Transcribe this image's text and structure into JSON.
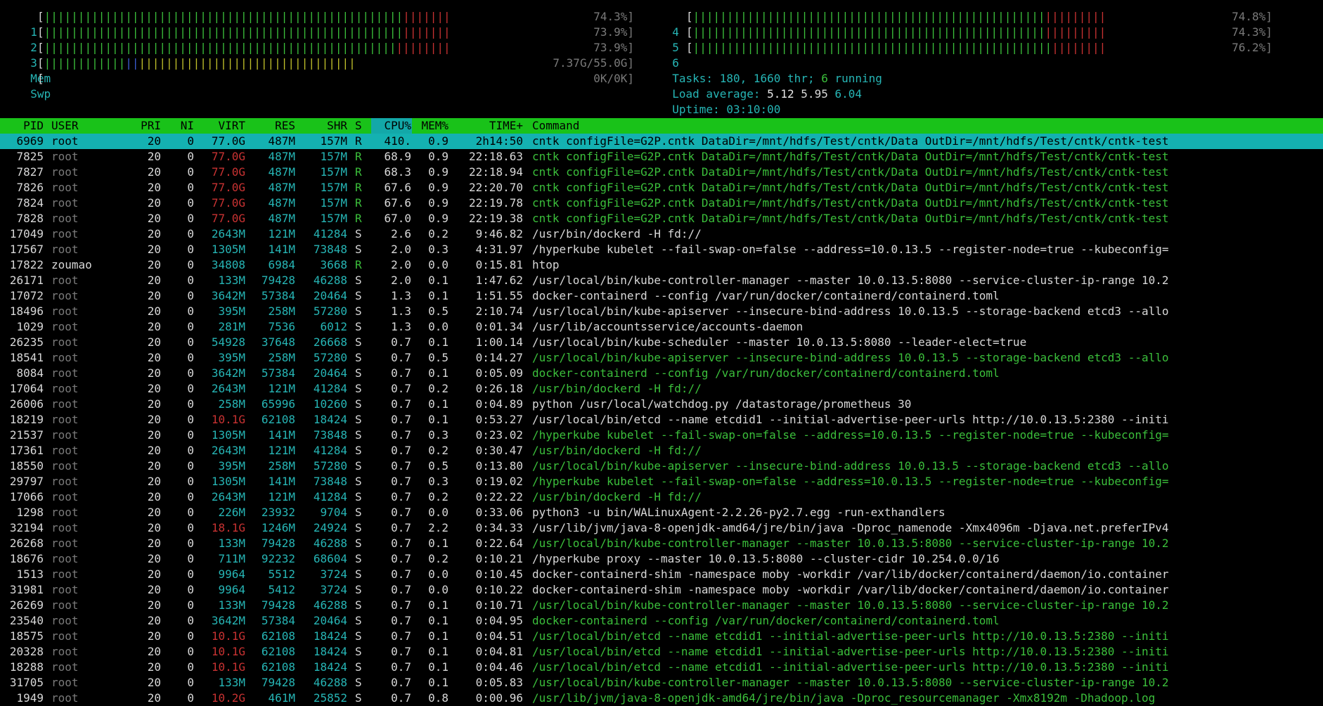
{
  "cpu_meters": [
    {
      "label": "1",
      "green": 53,
      "red": 7,
      "value": "74.3%]"
    },
    {
      "label": "2",
      "green": 53,
      "red": 7,
      "value": "73.9%]"
    },
    {
      "label": "3",
      "green": 52,
      "red": 8,
      "value": "73.9%]"
    },
    {
      "label": "4",
      "green": 52,
      "red": 9,
      "value": "74.8%]"
    },
    {
      "label": "5",
      "green": 52,
      "red": 9,
      "value": "74.3%]"
    },
    {
      "label": "6",
      "green": 53,
      "red": 8,
      "value": "76.2%]"
    }
  ],
  "mem": {
    "label": "Mem",
    "value": "7.37G/55.0G]"
  },
  "swp": {
    "label": "Swp",
    "value": "0K/0K]"
  },
  "tasks": {
    "label": "Tasks: ",
    "count": "180",
    "sep": ", ",
    "threads": "1660",
    "thr": " thr; ",
    "running": "6",
    "running_label": " running"
  },
  "load": {
    "label": "Load average: ",
    "v1": "5.12",
    "v5": "5.95",
    "v15": "6.04"
  },
  "uptime": {
    "label": "Uptime: ",
    "value": "03:10:00"
  },
  "columns": [
    "PID",
    "USER",
    "PRI",
    "NI",
    "VIRT",
    "RES",
    "SHR",
    "S",
    "CPU%",
    "MEM%",
    "TIME+",
    "Command"
  ],
  "processes": [
    {
      "pid": "6969",
      "user": "root",
      "pri": "20",
      "ni": "0",
      "virt": "77.0G",
      "res": "487M",
      "shr": "157M",
      "s": "R",
      "cpu": "410.",
      "mem": "0.9",
      "time": "2h14:50",
      "cmd": "cntk configFile=G2P.cntk DataDir=/mnt/hdfs/Test/cntk/Data OutDir=/mnt/hdfs/Test/cntk/cntk-test",
      "cmdcolor": "sel",
      "sel": true
    },
    {
      "pid": "7825",
      "user": "root",
      "pri": "20",
      "ni": "0",
      "virt": "77.0G",
      "res": "487M",
      "shr": "157M",
      "s": "R",
      "cpu": "68.9",
      "mem": "0.9",
      "time": "22:18.63",
      "cmd": "cntk configFile=G2P.cntk DataDir=/mnt/hdfs/Test/cntk/Data OutDir=/mnt/hdfs/Test/cntk/cntk-test",
      "cmdcolor": "green"
    },
    {
      "pid": "7827",
      "user": "root",
      "pri": "20",
      "ni": "0",
      "virt": "77.0G",
      "res": "487M",
      "shr": "157M",
      "s": "R",
      "cpu": "68.3",
      "mem": "0.9",
      "time": "22:18.94",
      "cmd": "cntk configFile=G2P.cntk DataDir=/mnt/hdfs/Test/cntk/Data OutDir=/mnt/hdfs/Test/cntk/cntk-test",
      "cmdcolor": "green"
    },
    {
      "pid": "7826",
      "user": "root",
      "pri": "20",
      "ni": "0",
      "virt": "77.0G",
      "res": "487M",
      "shr": "157M",
      "s": "R",
      "cpu": "67.6",
      "mem": "0.9",
      "time": "22:20.70",
      "cmd": "cntk configFile=G2P.cntk DataDir=/mnt/hdfs/Test/cntk/Data OutDir=/mnt/hdfs/Test/cntk/cntk-test",
      "cmdcolor": "green"
    },
    {
      "pid": "7824",
      "user": "root",
      "pri": "20",
      "ni": "0",
      "virt": "77.0G",
      "res": "487M",
      "shr": "157M",
      "s": "R",
      "cpu": "67.6",
      "mem": "0.9",
      "time": "22:19.78",
      "cmd": "cntk configFile=G2P.cntk DataDir=/mnt/hdfs/Test/cntk/Data OutDir=/mnt/hdfs/Test/cntk/cntk-test",
      "cmdcolor": "green"
    },
    {
      "pid": "7828",
      "user": "root",
      "pri": "20",
      "ni": "0",
      "virt": "77.0G",
      "res": "487M",
      "shr": "157M",
      "s": "R",
      "cpu": "67.0",
      "mem": "0.9",
      "time": "22:19.38",
      "cmd": "cntk configFile=G2P.cntk DataDir=/mnt/hdfs/Test/cntk/Data OutDir=/mnt/hdfs/Test/cntk/cntk-test",
      "cmdcolor": "green"
    },
    {
      "pid": "17049",
      "user": "root",
      "pri": "20",
      "ni": "0",
      "virt": "2643M",
      "res": "121M",
      "shr": "41284",
      "s": "S",
      "cpu": "2.6",
      "mem": "0.2",
      "time": "9:46.82",
      "cmd": "/usr/bin/dockerd -H fd://",
      "cmdcolor": "white"
    },
    {
      "pid": "17567",
      "user": "root",
      "pri": "20",
      "ni": "0",
      "virt": "1305M",
      "res": "141M",
      "shr": "73848",
      "s": "S",
      "cpu": "2.0",
      "mem": "0.3",
      "time": "4:31.97",
      "cmd": "/hyperkube kubelet --fail-swap-on=false --address=10.0.13.5 --register-node=true --kubeconfig=",
      "cmdcolor": "white"
    },
    {
      "pid": "17822",
      "user": "zoumao",
      "pri": "20",
      "ni": "0",
      "virt": "34808",
      "res": "6984",
      "shr": "3668",
      "s": "R",
      "cpu": "2.0",
      "mem": "0.0",
      "time": "0:15.81",
      "cmd": "htop",
      "cmdcolor": "white"
    },
    {
      "pid": "26171",
      "user": "root",
      "pri": "20",
      "ni": "0",
      "virt": "133M",
      "res": "79428",
      "shr": "46288",
      "s": "S",
      "cpu": "2.0",
      "mem": "0.1",
      "time": "1:47.62",
      "cmd": "/usr/local/bin/kube-controller-manager --master 10.0.13.5:8080 --service-cluster-ip-range 10.2",
      "cmdcolor": "white"
    },
    {
      "pid": "17072",
      "user": "root",
      "pri": "20",
      "ni": "0",
      "virt": "3642M",
      "res": "57384",
      "shr": "20464",
      "s": "S",
      "cpu": "1.3",
      "mem": "0.1",
      "time": "1:51.55",
      "cmd": "docker-containerd --config /var/run/docker/containerd/containerd.toml",
      "cmdcolor": "white"
    },
    {
      "pid": "18496",
      "user": "root",
      "pri": "20",
      "ni": "0",
      "virt": "395M",
      "res": "258M",
      "shr": "57280",
      "s": "S",
      "cpu": "1.3",
      "mem": "0.5",
      "time": "2:10.74",
      "cmd": "/usr/local/bin/kube-apiserver --insecure-bind-address 10.0.13.5 --storage-backend etcd3 --allo",
      "cmdcolor": "white"
    },
    {
      "pid": "1029",
      "user": "root",
      "pri": "20",
      "ni": "0",
      "virt": "281M",
      "res": "7536",
      "shr": "6012",
      "s": "S",
      "cpu": "1.3",
      "mem": "0.0",
      "time": "0:01.34",
      "cmd": "/usr/lib/accountsservice/accounts-daemon",
      "cmdcolor": "white"
    },
    {
      "pid": "26235",
      "user": "root",
      "pri": "20",
      "ni": "0",
      "virt": "54928",
      "res": "37648",
      "shr": "26668",
      "s": "S",
      "cpu": "0.7",
      "mem": "0.1",
      "time": "1:00.14",
      "cmd": "/usr/local/bin/kube-scheduler --master 10.0.13.5:8080 --leader-elect=true",
      "cmdcolor": "white"
    },
    {
      "pid": "18541",
      "user": "root",
      "pri": "20",
      "ni": "0",
      "virt": "395M",
      "res": "258M",
      "shr": "57280",
      "s": "S",
      "cpu": "0.7",
      "mem": "0.5",
      "time": "0:14.27",
      "cmd": "/usr/local/bin/kube-apiserver --insecure-bind-address 10.0.13.5 --storage-backend etcd3 --allo",
      "cmdcolor": "green"
    },
    {
      "pid": "8084",
      "user": "root",
      "pri": "20",
      "ni": "0",
      "virt": "3642M",
      "res": "57384",
      "shr": "20464",
      "s": "S",
      "cpu": "0.7",
      "mem": "0.1",
      "time": "0:05.09",
      "cmd": "docker-containerd --config /var/run/docker/containerd/containerd.toml",
      "cmdcolor": "green"
    },
    {
      "pid": "17064",
      "user": "root",
      "pri": "20",
      "ni": "0",
      "virt": "2643M",
      "res": "121M",
      "shr": "41284",
      "s": "S",
      "cpu": "0.7",
      "mem": "0.2",
      "time": "0:26.18",
      "cmd": "/usr/bin/dockerd -H fd://",
      "cmdcolor": "green"
    },
    {
      "pid": "26006",
      "user": "root",
      "pri": "20",
      "ni": "0",
      "virt": "258M",
      "res": "65996",
      "shr": "10260",
      "s": "S",
      "cpu": "0.7",
      "mem": "0.1",
      "time": "0:04.89",
      "cmd": "python /usr/local/watchdog.py /datastorage/prometheus 30",
      "cmdcolor": "white"
    },
    {
      "pid": "18219",
      "user": "root",
      "pri": "20",
      "ni": "0",
      "virt": "10.1G",
      "res": "62108",
      "shr": "18424",
      "s": "S",
      "cpu": "0.7",
      "mem": "0.1",
      "time": "0:53.27",
      "cmd": "/usr/local/bin/etcd --name etcdid1 --initial-advertise-peer-urls http://10.0.13.5:2380 --initi",
      "cmdcolor": "white"
    },
    {
      "pid": "21537",
      "user": "root",
      "pri": "20",
      "ni": "0",
      "virt": "1305M",
      "res": "141M",
      "shr": "73848",
      "s": "S",
      "cpu": "0.7",
      "mem": "0.3",
      "time": "0:23.02",
      "cmd": "/hyperkube kubelet --fail-swap-on=false --address=10.0.13.5 --register-node=true --kubeconfig=",
      "cmdcolor": "green"
    },
    {
      "pid": "17361",
      "user": "root",
      "pri": "20",
      "ni": "0",
      "virt": "2643M",
      "res": "121M",
      "shr": "41284",
      "s": "S",
      "cpu": "0.7",
      "mem": "0.2",
      "time": "0:30.47",
      "cmd": "/usr/bin/dockerd -H fd://",
      "cmdcolor": "green"
    },
    {
      "pid": "18550",
      "user": "root",
      "pri": "20",
      "ni": "0",
      "virt": "395M",
      "res": "258M",
      "shr": "57280",
      "s": "S",
      "cpu": "0.7",
      "mem": "0.5",
      "time": "0:13.80",
      "cmd": "/usr/local/bin/kube-apiserver --insecure-bind-address 10.0.13.5 --storage-backend etcd3 --allo",
      "cmdcolor": "green"
    },
    {
      "pid": "29797",
      "user": "root",
      "pri": "20",
      "ni": "0",
      "virt": "1305M",
      "res": "141M",
      "shr": "73848",
      "s": "S",
      "cpu": "0.7",
      "mem": "0.3",
      "time": "0:19.02",
      "cmd": "/hyperkube kubelet --fail-swap-on=false --address=10.0.13.5 --register-node=true --kubeconfig=",
      "cmdcolor": "green"
    },
    {
      "pid": "17066",
      "user": "root",
      "pri": "20",
      "ni": "0",
      "virt": "2643M",
      "res": "121M",
      "shr": "41284",
      "s": "S",
      "cpu": "0.7",
      "mem": "0.2",
      "time": "0:22.22",
      "cmd": "/usr/bin/dockerd -H fd://",
      "cmdcolor": "green"
    },
    {
      "pid": "1298",
      "user": "root",
      "pri": "20",
      "ni": "0",
      "virt": "226M",
      "res": "23932",
      "shr": "9704",
      "s": "S",
      "cpu": "0.7",
      "mem": "0.0",
      "time": "0:33.06",
      "cmd": "python3 -u bin/WALinuxAgent-2.2.26-py2.7.egg -run-exthandlers",
      "cmdcolor": "white"
    },
    {
      "pid": "32194",
      "user": "root",
      "pri": "20",
      "ni": "0",
      "virt": "18.1G",
      "res": "1246M",
      "shr": "24924",
      "s": "S",
      "cpu": "0.7",
      "mem": "2.2",
      "time": "0:34.33",
      "cmd": "/usr/lib/jvm/java-8-openjdk-amd64/jre/bin/java -Dproc_namenode -Xmx4096m -Djava.net.preferIPv4",
      "cmdcolor": "white"
    },
    {
      "pid": "26268",
      "user": "root",
      "pri": "20",
      "ni": "0",
      "virt": "133M",
      "res": "79428",
      "shr": "46288",
      "s": "S",
      "cpu": "0.7",
      "mem": "0.1",
      "time": "0:22.64",
      "cmd": "/usr/local/bin/kube-controller-manager --master 10.0.13.5:8080 --service-cluster-ip-range 10.2",
      "cmdcolor": "green"
    },
    {
      "pid": "18676",
      "user": "root",
      "pri": "20",
      "ni": "0",
      "virt": "711M",
      "res": "92232",
      "shr": "68604",
      "s": "S",
      "cpu": "0.7",
      "mem": "0.2",
      "time": "0:10.21",
      "cmd": "/hyperkube proxy --master 10.0.13.5:8080 --cluster-cidr 10.254.0.0/16",
      "cmdcolor": "white"
    },
    {
      "pid": "1513",
      "user": "root",
      "pri": "20",
      "ni": "0",
      "virt": "9964",
      "res": "5512",
      "shr": "3724",
      "s": "S",
      "cpu": "0.7",
      "mem": "0.0",
      "time": "0:10.45",
      "cmd": "docker-containerd-shim -namespace moby -workdir /var/lib/docker/containerd/daemon/io.container",
      "cmdcolor": "white"
    },
    {
      "pid": "31981",
      "user": "root",
      "pri": "20",
      "ni": "0",
      "virt": "9964",
      "res": "5412",
      "shr": "3724",
      "s": "S",
      "cpu": "0.7",
      "mem": "0.0",
      "time": "0:10.22",
      "cmd": "docker-containerd-shim -namespace moby -workdir /var/lib/docker/containerd/daemon/io.container",
      "cmdcolor": "white"
    },
    {
      "pid": "26269",
      "user": "root",
      "pri": "20",
      "ni": "0",
      "virt": "133M",
      "res": "79428",
      "shr": "46288",
      "s": "S",
      "cpu": "0.7",
      "mem": "0.1",
      "time": "0:10.71",
      "cmd": "/usr/local/bin/kube-controller-manager --master 10.0.13.5:8080 --service-cluster-ip-range 10.2",
      "cmdcolor": "green"
    },
    {
      "pid": "23540",
      "user": "root",
      "pri": "20",
      "ni": "0",
      "virt": "3642M",
      "res": "57384",
      "shr": "20464",
      "s": "S",
      "cpu": "0.7",
      "mem": "0.1",
      "time": "0:04.95",
      "cmd": "docker-containerd --config /var/run/docker/containerd/containerd.toml",
      "cmdcolor": "green"
    },
    {
      "pid": "18575",
      "user": "root",
      "pri": "20",
      "ni": "0",
      "virt": "10.1G",
      "res": "62108",
      "shr": "18424",
      "s": "S",
      "cpu": "0.7",
      "mem": "0.1",
      "time": "0:04.51",
      "cmd": "/usr/local/bin/etcd --name etcdid1 --initial-advertise-peer-urls http://10.0.13.5:2380 --initi",
      "cmdcolor": "green"
    },
    {
      "pid": "20328",
      "user": "root",
      "pri": "20",
      "ni": "0",
      "virt": "10.1G",
      "res": "62108",
      "shr": "18424",
      "s": "S",
      "cpu": "0.7",
      "mem": "0.1",
      "time": "0:04.81",
      "cmd": "/usr/local/bin/etcd --name etcdid1 --initial-advertise-peer-urls http://10.0.13.5:2380 --initi",
      "cmdcolor": "green"
    },
    {
      "pid": "18288",
      "user": "root",
      "pri": "20",
      "ni": "0",
      "virt": "10.1G",
      "res": "62108",
      "shr": "18424",
      "s": "S",
      "cpu": "0.7",
      "mem": "0.1",
      "time": "0:04.46",
      "cmd": "/usr/local/bin/etcd --name etcdid1 --initial-advertise-peer-urls http://10.0.13.5:2380 --initi",
      "cmdcolor": "green"
    },
    {
      "pid": "31705",
      "user": "root",
      "pri": "20",
      "ni": "0",
      "virt": "133M",
      "res": "79428",
      "shr": "46288",
      "s": "S",
      "cpu": "0.7",
      "mem": "0.1",
      "time": "0:05.83",
      "cmd": "/usr/local/bin/kube-controller-manager --master 10.0.13.5:8080 --service-cluster-ip-range 10.2",
      "cmdcolor": "green"
    },
    {
      "pid": "1949",
      "user": "root",
      "pri": "20",
      "ni": "0",
      "virt": "10.2G",
      "res": "461M",
      "shr": "25852",
      "s": "S",
      "cpu": "0.7",
      "mem": "0.8",
      "time": "0:00.96",
      "cmd": "/usr/lib/jvm/java-8-openjdk-amd64/jre/bin/java -Dproc_resourcemanager -Xmx8192m -Dhadoop.log",
      "cmdcolor": "green"
    }
  ]
}
